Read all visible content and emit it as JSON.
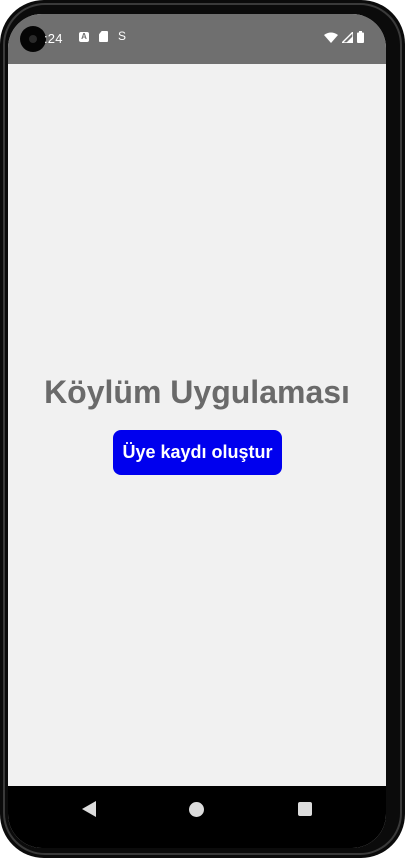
{
  "status_bar": {
    "time": ":24",
    "icons_left": [
      "a-notification-icon",
      "sd-card-icon",
      "s-notification-icon"
    ],
    "icon_a_letter": "A",
    "icon_s_glyph": "S",
    "icons_right": [
      "wifi-icon",
      "cellular-signal-icon",
      "battery-icon"
    ]
  },
  "app": {
    "title": "Köylüm Uygulaması",
    "register_button_label": "Üye kaydı oluştur"
  },
  "nav_bar": {
    "buttons": [
      "back-button",
      "home-button",
      "recents-button"
    ]
  },
  "colors": {
    "status_bar": "#6f6f6f",
    "background": "#f1f1f1",
    "title_text": "#6a6a6a",
    "button": "#0000ee",
    "button_text": "#ffffff",
    "nav_bar": "#000000"
  }
}
